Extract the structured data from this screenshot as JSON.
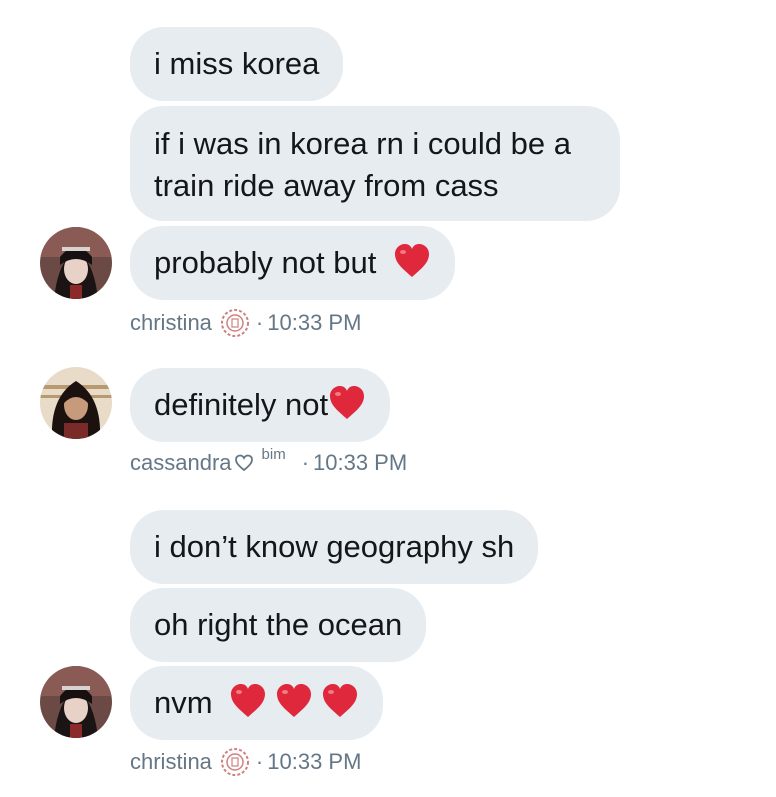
{
  "messages": [
    {
      "text": "i miss korea"
    },
    {
      "text": "if i was in korea rn i could be a train ride away from cass"
    },
    {
      "text": "probably not but"
    },
    {
      "text": "definitely not"
    },
    {
      "text": "i don’t know geography sh"
    },
    {
      "text": "oh right the ocean"
    },
    {
      "text": "nvm"
    }
  ],
  "meta": {
    "christina_1": {
      "name": "christina",
      "dot": "·",
      "time": "10:33 PM"
    },
    "cassandra": {
      "name": "cassandra",
      "badge": "bim",
      "dot": "·",
      "time": "10:33 PM"
    },
    "christina_2": {
      "name": "christina",
      "dot": "·",
      "time": "10:33 PM"
    }
  },
  "icons": {
    "heart": "red-heart-emoji",
    "seal": "flower-seal-emoji",
    "outline_heart": "outline-heart"
  },
  "colors": {
    "bubble": "#e6ecf0",
    "text": "#14171a",
    "meta": "#657786",
    "heart": "#e0283c"
  }
}
